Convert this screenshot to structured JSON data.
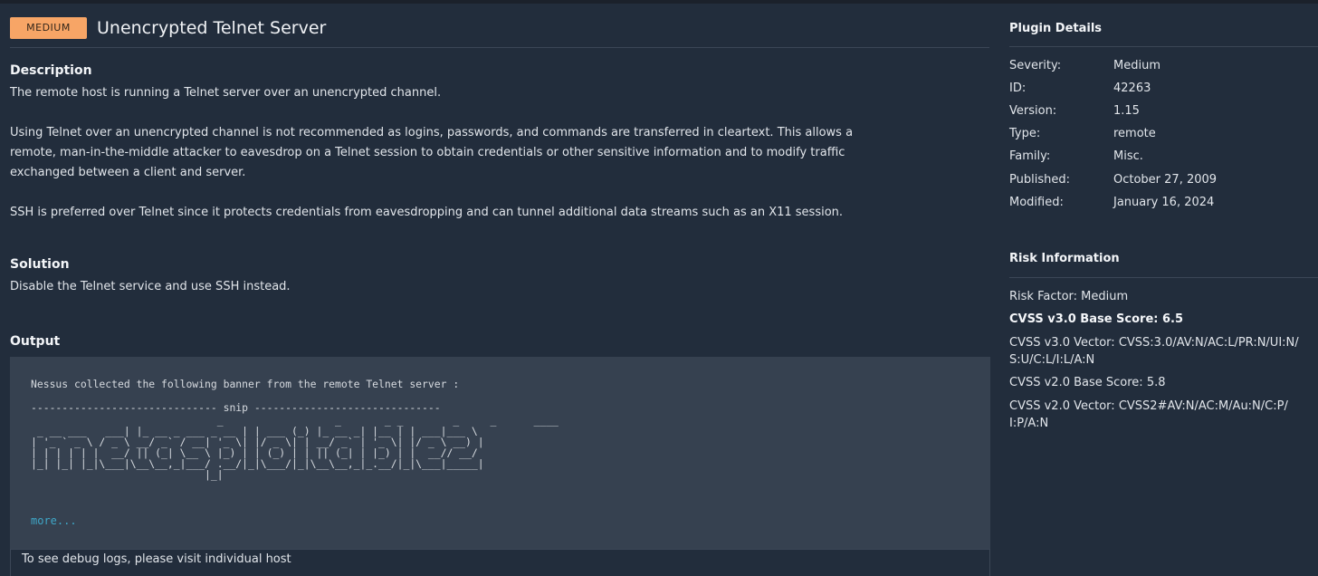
{
  "header": {
    "severity_badge": "MEDIUM",
    "title": "Unencrypted Telnet Server"
  },
  "description": {
    "heading": "Description",
    "paragraphs": [
      "The remote host is running a Telnet server over an unencrypted channel.",
      "Using Telnet over an unencrypted channel is not recommended as logins, passwords, and commands are transferred in cleartext. This allows a remote, man-in-the-middle attacker to eavesdrop on a Telnet session to obtain credentials or other sensitive information and to modify traffic exchanged between a client and server.",
      "SSH is preferred over Telnet since it protects credentials from eavesdropping and can tunnel additional data streams such as an X11 session."
    ]
  },
  "solution": {
    "heading": "Solution",
    "text": "Disable the Telnet service and use SSH instead."
  },
  "output": {
    "heading": "Output",
    "lead": "Nessus collected the following banner from the remote Telnet server :",
    "snip": "------------------------------ snip ------------------------------",
    "banner": "                              _                  _       _ _        _     _      ____  \n _ __ ___   ___| |_ __ _ ___ _ __ | | ___ (_) |_ __ _| |__ | | ___|___ \\ \n| '_ ` _ \\ / _ \\ __/ _` / __| '_ \\| |/ _ \\| | __/ _` | '_ \\| |/ _ \\ __) |\n| | | | | |  __/ || (_| \\__ \\ |_) | | (_) | | || (_| | |_) | |  __// __/ \n|_| |_| |_|\\___|\\__\\__,_|___/ .__/|_|\\___/|_|\\__\\__,_|_.__/|_|\\___|_____|\n                            |_|",
    "more_link": "more...",
    "debug_text": "To see debug logs, please visit individual host"
  },
  "plugin_details": {
    "heading": "Plugin Details",
    "rows": [
      {
        "key": "Severity:",
        "value": "Medium"
      },
      {
        "key": "ID:",
        "value": "42263"
      },
      {
        "key": "Version:",
        "value": "1.15"
      },
      {
        "key": "Type:",
        "value": "remote"
      },
      {
        "key": "Family:",
        "value": "Misc."
      },
      {
        "key": "Published:",
        "value": "October 27, 2009"
      },
      {
        "key": "Modified:",
        "value": "January 16, 2024"
      }
    ]
  },
  "risk_information": {
    "heading": "Risk Information",
    "risk_factor": "Risk Factor: Medium",
    "cvss3_base": "CVSS v3.0 Base Score: 6.5",
    "cvss3_vector_1": "CVSS v3.0 Vector: CVSS:3.0/AV:N/AC:L/PR:N/UI:N/",
    "cvss3_vector_2": "S:U/C:L/I:L/A:N",
    "cvss2_base": "CVSS v2.0 Base Score: 5.8",
    "cvss2_vector_1": "CVSS v2.0 Vector: CVSS2#AV:N/AC:M/Au:N/C:P/",
    "cvss2_vector_2": "I:P/A:N"
  },
  "colors": {
    "background": "#222d3c",
    "badge_medium": "#f7a566",
    "output_box": "#364150",
    "link": "#3fa7c8"
  }
}
